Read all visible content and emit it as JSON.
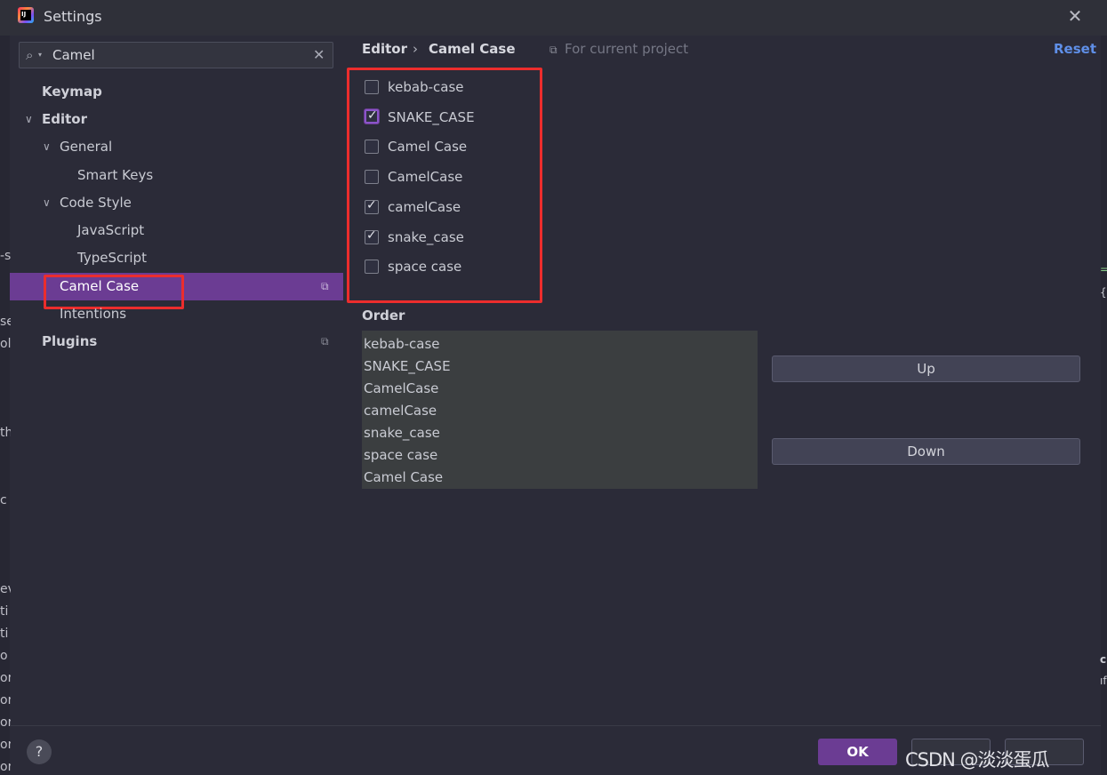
{
  "window": {
    "title": "Settings"
  },
  "search": {
    "value": "Camel"
  },
  "tree": {
    "keymap": "Keymap",
    "editor": "Editor",
    "general": "General",
    "smart_keys": "Smart Keys",
    "code_style": "Code Style",
    "javascript": "JavaScript",
    "typescript": "TypeScript",
    "camel_case": "Camel Case",
    "intentions": "Intentions",
    "plugins": "Plugins"
  },
  "breadcrumb": {
    "parent": "Editor",
    "separator": "›",
    "current": "Camel Case",
    "scope": "For current project"
  },
  "reset_label": "Reset",
  "options": [
    {
      "label": "kebab-case",
      "checked": false
    },
    {
      "label": "SNAKE_CASE",
      "checked": true
    },
    {
      "label": "Camel Case",
      "checked": false
    },
    {
      "label": "CamelCase",
      "checked": false
    },
    {
      "label": "camelCase",
      "checked": true
    },
    {
      "label": "snake_case",
      "checked": true
    },
    {
      "label": "space case",
      "checked": false
    }
  ],
  "order": {
    "title": "Order",
    "items": [
      "kebab-case",
      "SNAKE_CASE",
      "CamelCase",
      "camelCase",
      "snake_case",
      "space case",
      "Camel Case"
    ]
  },
  "buttons": {
    "up": "Up",
    "down": "Down",
    "ok": "OK",
    "help": "?"
  },
  "watermark": "CSDN @淡淡蛋瓜",
  "editor_fragments": {
    "left": [
      "-s",
      "se",
      "ol",
      "th",
      "c",
      "ev",
      "ti",
      "ti",
      "o",
      "or",
      "or",
      "or",
      "or",
      "or"
    ],
    "right": [
      "=",
      "{",
      "c",
      "ıf"
    ]
  },
  "colors": {
    "accent": "#6b3c93",
    "highlight": "#ec2d2d",
    "link": "#5f8fe8"
  }
}
